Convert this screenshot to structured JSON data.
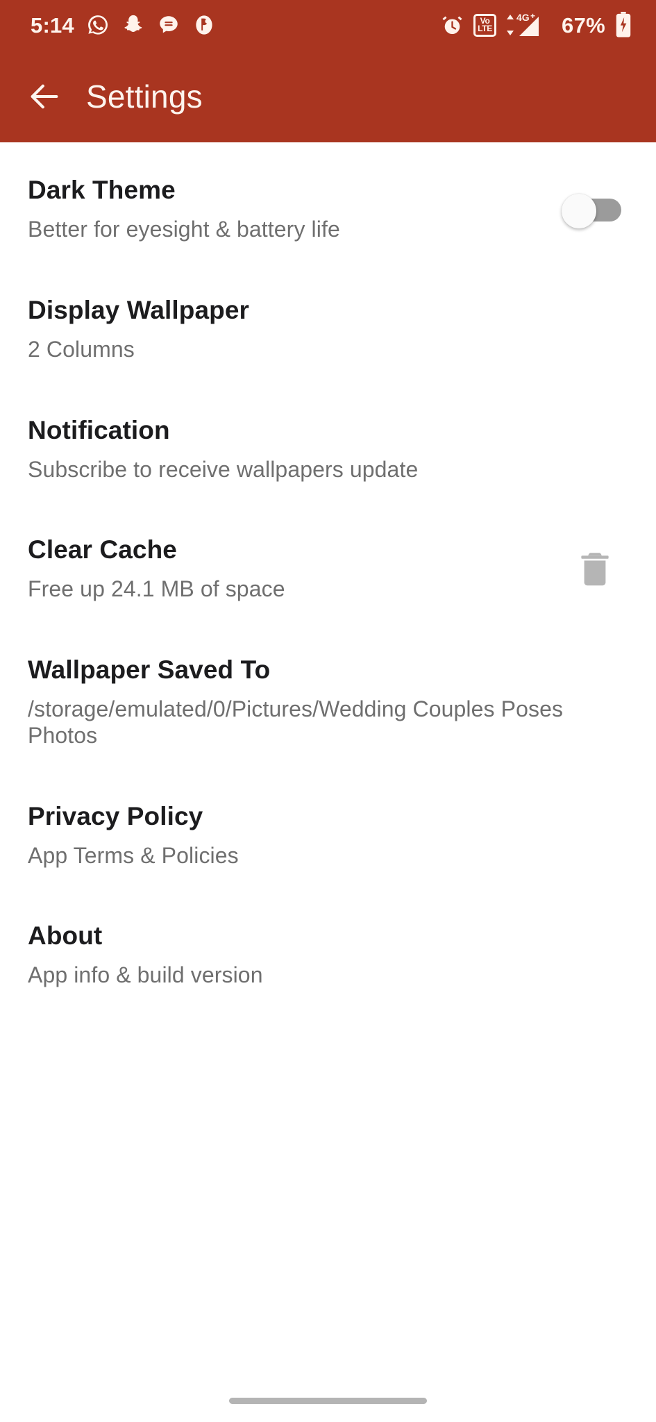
{
  "theme": {
    "accent": "#A93520",
    "appbar_text": "#FDF4EE",
    "title_color": "#1C1C1E",
    "subtitle_color": "#6F6F6F",
    "background": "#FFFFFF",
    "switch_track_off": "#9B9B9B",
    "switch_thumb_off": "#FAFAFA",
    "trash_icon_color": "#B5B5B5",
    "nav_pill_color": "#B4B4B4"
  },
  "status_bar": {
    "time": "5:14",
    "left_icons": [
      "whatsapp-icon",
      "snapchat-icon",
      "message-icon",
      "app-notification-icon"
    ],
    "right_icons": [
      "alarm-icon",
      "volte-icon",
      "signal-4g-plus-icon",
      "battery-charging-icon"
    ],
    "volte_top": "Vo",
    "volte_bottom": "LTE",
    "network_label": "4G+",
    "battery_percent": "67%"
  },
  "app_bar": {
    "back_icon": "arrow-back-icon",
    "title": "Settings"
  },
  "settings": {
    "items": [
      {
        "id": "dark-theme",
        "title": "Dark Theme",
        "subtitle": "Better for eyesight & battery life",
        "accessory": "toggle-switch",
        "toggle_state": "off"
      },
      {
        "id": "display-wallpaper",
        "title": "Display Wallpaper",
        "subtitle": "2 Columns",
        "accessory": "none"
      },
      {
        "id": "notification",
        "title": "Notification",
        "subtitle": "Subscribe to receive wallpapers update",
        "accessory": "none"
      },
      {
        "id": "clear-cache",
        "title": "Clear Cache",
        "subtitle": "Free up 24.1 MB of space",
        "accessory": "trash-icon"
      },
      {
        "id": "wallpaper-saved-to",
        "title": "Wallpaper Saved To",
        "subtitle": "/storage/emulated/0/Pictures/Wedding Couples Poses Photos",
        "accessory": "none"
      },
      {
        "id": "privacy-policy",
        "title": "Privacy Policy",
        "subtitle": "App Terms & Policies",
        "accessory": "none"
      },
      {
        "id": "about",
        "title": "About",
        "subtitle": "App info & build version",
        "accessory": "none"
      }
    ]
  },
  "navigation_bar": {
    "gesture_pill": "home-gesture-pill"
  }
}
